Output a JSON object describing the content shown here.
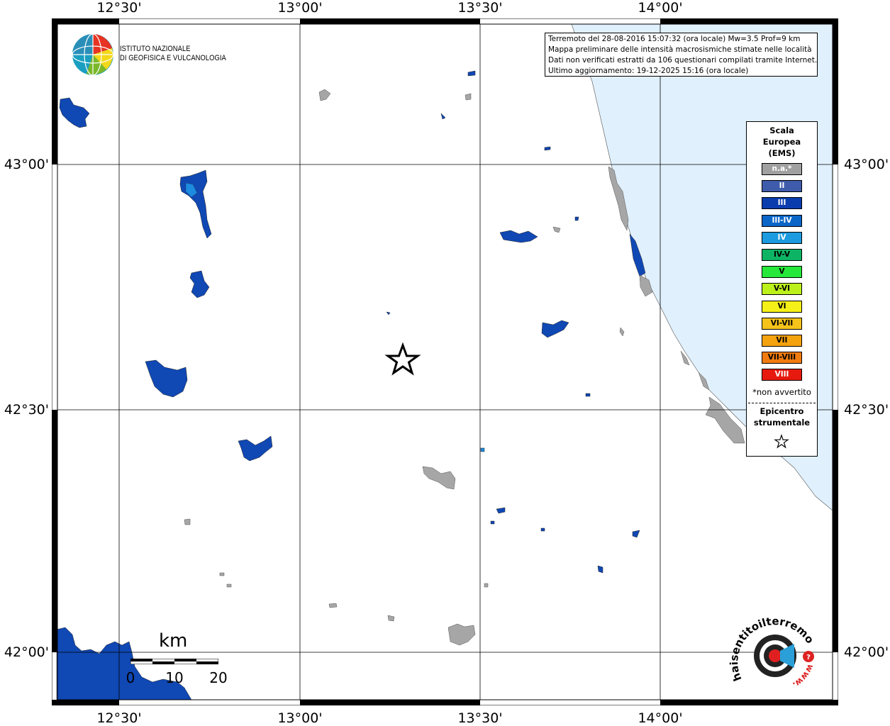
{
  "map": {
    "top_lon_labels": [
      "12°30'",
      "13°00'",
      "13°30'",
      "14°00'"
    ],
    "bottom_lon_labels": [
      "12°30'",
      "13°00'",
      "13°30'",
      "14°00'"
    ],
    "left_lat_labels": [
      "43°00'",
      "42°30'",
      "42°00'"
    ],
    "right_lat_labels": [
      "43°00'",
      "42°30'",
      "42°00'"
    ],
    "sea_color": "#e0f0fc",
    "graticule_color": "#000000"
  },
  "institute": {
    "line1": "ISTITUTO NAZIONALE",
    "line2": "DI GEOFISICA E VULCANOLOGIA"
  },
  "info": {
    "line1": "Terremoto del 28-08-2016 15:07:32 (ora locale) Mw=3.5 Prof=9 km",
    "line2": "Mappa preliminare delle intensità macrosismiche stimate nelle località",
    "line3": "Dati non verificati estratti da 106 questionari compilati tramite Internet.",
    "line4": "Ultimo aggiornamento: 19-12-2025 15:16 (ora locale)"
  },
  "legend": {
    "title_line1": "Scala",
    "title_line2": "Europea",
    "title_line3": "(EMS)",
    "items": [
      {
        "label": "n.a.*",
        "color": "#a0a0a0",
        "text_color": "#ffffff"
      },
      {
        "label": "II",
        "color": "#3f5bab",
        "text_color": "#ffffff"
      },
      {
        "label": "III",
        "color": "#0b3cae",
        "text_color": "#ffffff"
      },
      {
        "label": "III-IV",
        "color": "#0b66c8",
        "text_color": "#ffffff"
      },
      {
        "label": "IV",
        "color": "#1c9be0",
        "text_color": "#ffffff"
      },
      {
        "label": "IV-V",
        "color": "#0db464",
        "text_color": "#000000"
      },
      {
        "label": "V",
        "color": "#26e83a",
        "text_color": "#000000"
      },
      {
        "label": "V-VI",
        "color": "#bcf01a",
        "text_color": "#000000"
      },
      {
        "label": "VI",
        "color": "#f5f018",
        "text_color": "#000000"
      },
      {
        "label": "VI-VII",
        "color": "#f5c31a",
        "text_color": "#000000"
      },
      {
        "label": "VII",
        "color": "#f5a20f",
        "text_color": "#000000"
      },
      {
        "label": "VII-VIII",
        "color": "#f07b0f",
        "text_color": "#000000"
      },
      {
        "label": "VIII",
        "color": "#e61a0f",
        "text_color": "#ffffff"
      }
    ],
    "note": "*non avvertito",
    "epicenter_line1": "Epicentro",
    "epicenter_line2": "strumentale",
    "epicenter_icon": "star-icon"
  },
  "scale": {
    "unit": "km",
    "ticks": [
      "0",
      "10",
      "20"
    ]
  },
  "haisentito": {
    "brand": "haisentitoilterremoto.it",
    "url": "www."
  }
}
